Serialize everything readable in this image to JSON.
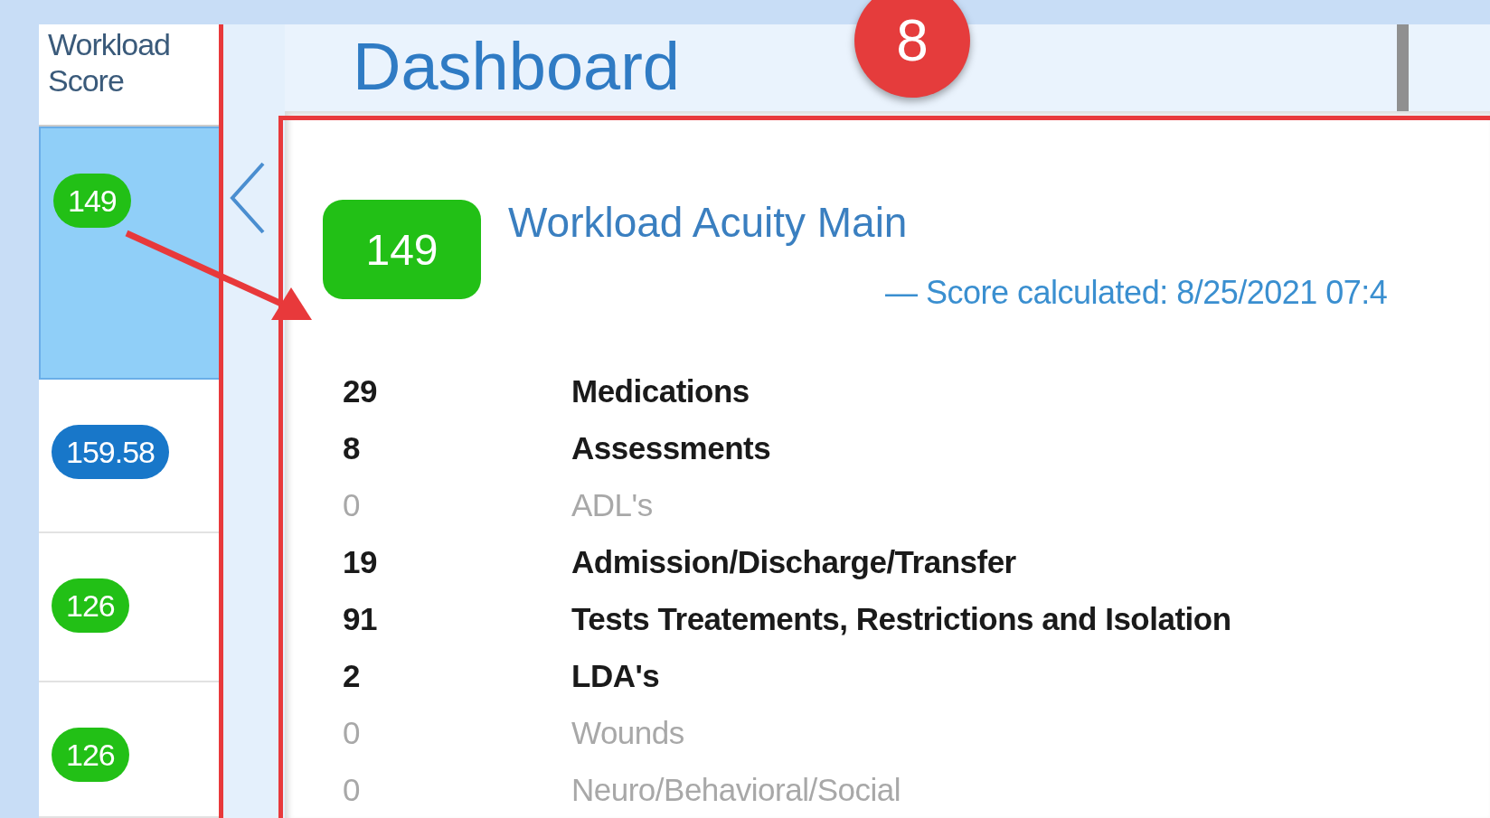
{
  "sidebar": {
    "header": "Workload Score",
    "rows": [
      {
        "score": "149",
        "color": "#22c016",
        "selected": true
      },
      {
        "score": "159.58",
        "color": "#1877c9",
        "selected": false
      },
      {
        "score": "126",
        "color": "#22c016",
        "selected": false
      },
      {
        "score": "126",
        "color": "#22c016",
        "selected": false
      }
    ]
  },
  "header": {
    "title": "Dashboard"
  },
  "annotation": {
    "badge": "8"
  },
  "panel": {
    "score": "149",
    "title": "Workload Acuity Main",
    "subtitle": "— Score calculated: 8/25/2021 07:4",
    "items": [
      {
        "value": "29",
        "label": "Medications",
        "dimmed": false
      },
      {
        "value": "8",
        "label": "Assessments",
        "dimmed": false
      },
      {
        "value": "0",
        "label": "ADL's",
        "dimmed": true
      },
      {
        "value": "19",
        "label": "Admission/Discharge/Transfer",
        "dimmed": false
      },
      {
        "value": "91",
        "label": "Tests Treatements, Restrictions and Isolation",
        "dimmed": false
      },
      {
        "value": "2",
        "label": "LDA's",
        "dimmed": false
      },
      {
        "value": "0",
        "label": "Wounds",
        "dimmed": true
      },
      {
        "value": "0",
        "label": "Neuro/Behavioral/Social",
        "dimmed": true
      }
    ]
  }
}
